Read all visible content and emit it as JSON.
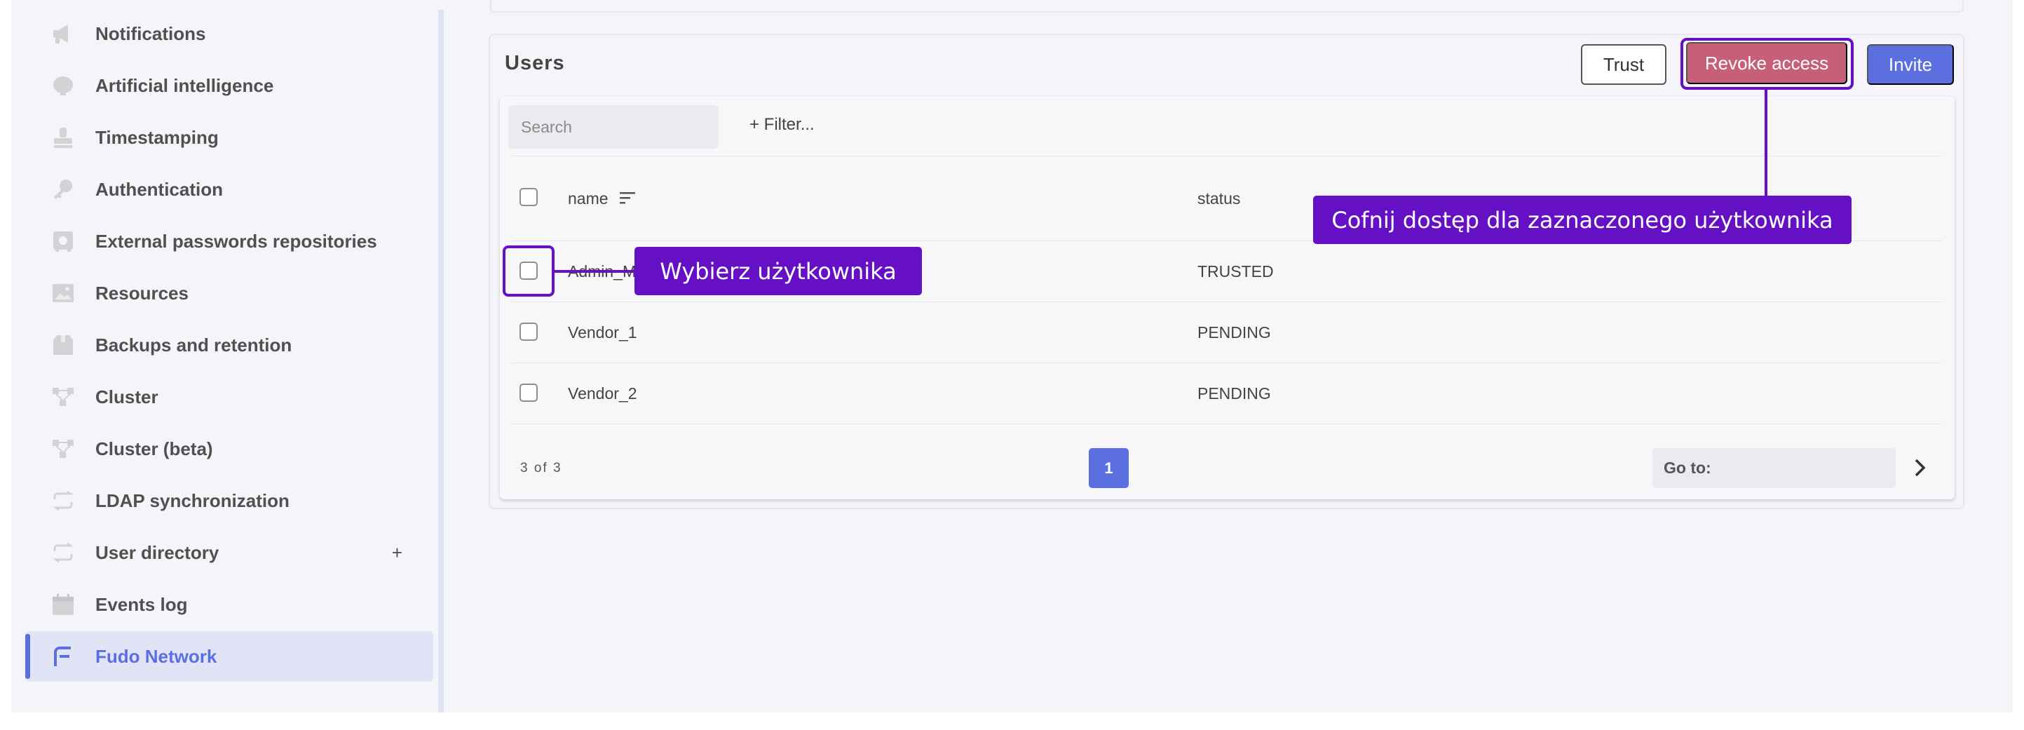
{
  "sidebar": {
    "items": [
      {
        "label": "Notifications",
        "icon": "megaphone-icon"
      },
      {
        "label": "Artificial intelligence",
        "icon": "brain-icon"
      },
      {
        "label": "Timestamping",
        "icon": "stamp-icon"
      },
      {
        "label": "Authentication",
        "icon": "key-icon"
      },
      {
        "label": "External passwords repositories",
        "icon": "safe-icon"
      },
      {
        "label": "Resources",
        "icon": "image-icon"
      },
      {
        "label": "Backups and retention",
        "icon": "box-icon"
      },
      {
        "label": "Cluster",
        "icon": "network-icon"
      },
      {
        "label": "Cluster (beta)",
        "icon": "network-icon"
      },
      {
        "label": "LDAP synchronization",
        "icon": "sync-icon"
      },
      {
        "label": "User directory",
        "icon": "sync-icon",
        "action": "+"
      },
      {
        "label": "Events log",
        "icon": "calendar-icon"
      },
      {
        "label": "Fudo Network",
        "icon": "fudo-logo-icon",
        "active": true
      }
    ]
  },
  "users": {
    "title": "Users",
    "buttons": {
      "trust": "Trust",
      "revoke": "Revoke access",
      "invite": "Invite"
    },
    "search": {
      "placeholder": "Search",
      "value": ""
    },
    "filter_label": "+ Filter...",
    "columns": {
      "name": "name",
      "status": "status"
    },
    "rows": [
      {
        "name": "Admin_M",
        "status": "TRUSTED"
      },
      {
        "name": "Vendor_1",
        "status": "PENDING"
      },
      {
        "name": "Vendor_2",
        "status": "PENDING"
      }
    ],
    "pagination": {
      "count": "3 of 3",
      "current_page": "1",
      "goto_label": "Go to:"
    }
  },
  "annotations": {
    "select_user": "Wybierz użytkownika",
    "revoke_access": "Cofnij dostęp dla zaznaczonego użytkownika"
  },
  "colors": {
    "accent": "#5b6fe0",
    "danger": "#c65f78",
    "annotation": "#6510c4"
  }
}
